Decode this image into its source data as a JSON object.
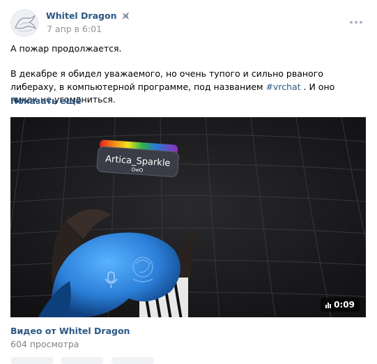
{
  "post": {
    "author": "Whitel Dragon",
    "date": "7 апр в 6:01",
    "text_line1": "А пожар продолжается.",
    "text_line2_before": "В декабре я обидел уважаемого, но очень тупого и сильно рваного либераху, в компьютерной программе, под названием ",
    "hashtag": "#vrchat",
    "text_line2_after": " . И оно никак не угомониться.",
    "show_more": "Показать ещё"
  },
  "video": {
    "nameplate_name": "Artica_Sparkle",
    "nameplate_sub": "OwO",
    "duration": "0:09",
    "title": "Видео от Whitel Dragon",
    "views": "604 просмотра"
  },
  "icons": {
    "avatar": "dragon-avatar",
    "author_badge": "dragon-badge-icon",
    "more": "more-dots-icon",
    "duration": "sound-bars-icon",
    "mic": "mic-icon"
  },
  "colors": {
    "link": "#2a5885",
    "secondary": "#939393",
    "video_bg": "#17171a",
    "avatar_blue": "#2f7fd6"
  }
}
